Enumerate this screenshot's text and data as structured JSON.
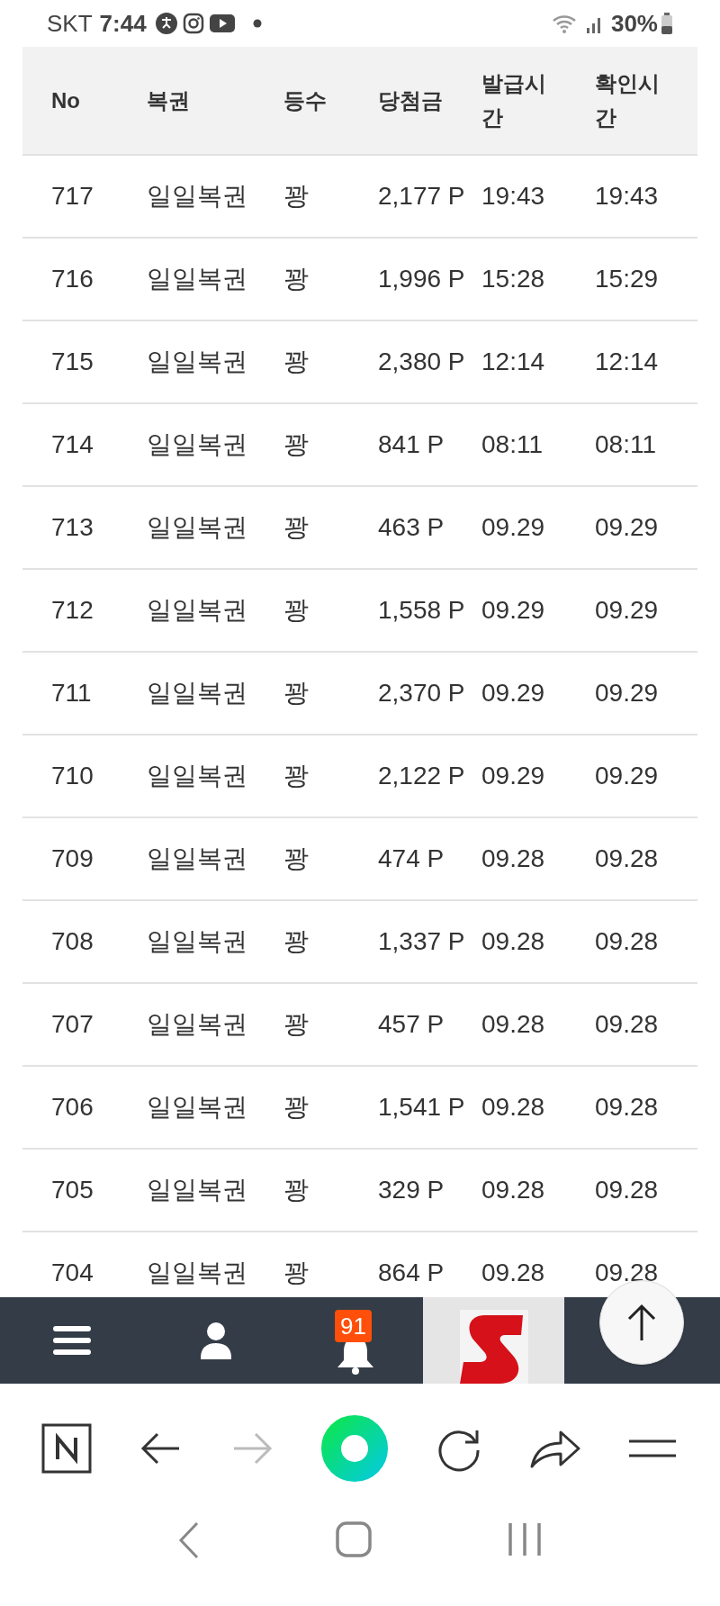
{
  "status_bar": {
    "carrier": "SKT",
    "time": "7:44",
    "battery": "30%"
  },
  "table": {
    "columns": [
      "No",
      "복권",
      "등수",
      "당첨금",
      "발급시간",
      "확인시간"
    ],
    "rows": [
      [
        "717",
        "일일복권",
        "꽝",
        "2,177 P",
        "19:43",
        "19:43"
      ],
      [
        "716",
        "일일복권",
        "꽝",
        "1,996 P",
        "15:28",
        "15:29"
      ],
      [
        "715",
        "일일복권",
        "꽝",
        "2,380 P",
        "12:14",
        "12:14"
      ],
      [
        "714",
        "일일복권",
        "꽝",
        "841 P",
        "08:11",
        "08:11"
      ],
      [
        "713",
        "일일복권",
        "꽝",
        "463 P",
        "09.29",
        "09.29"
      ],
      [
        "712",
        "일일복권",
        "꽝",
        "1,558 P",
        "09.29",
        "09.29"
      ],
      [
        "711",
        "일일복권",
        "꽝",
        "2,370 P",
        "09.29",
        "09.29"
      ],
      [
        "710",
        "일일복권",
        "꽝",
        "2,122 P",
        "09.29",
        "09.29"
      ],
      [
        "709",
        "일일복권",
        "꽝",
        "474 P",
        "09.28",
        "09.28"
      ],
      [
        "708",
        "일일복권",
        "꽝",
        "1,337 P",
        "09.28",
        "09.28"
      ],
      [
        "707",
        "일일복권",
        "꽝",
        "457 P",
        "09.28",
        "09.28"
      ],
      [
        "706",
        "일일복권",
        "꽝",
        "1,541 P",
        "09.28",
        "09.28"
      ],
      [
        "705",
        "일일복권",
        "꽝",
        "329 P",
        "09.28",
        "09.28"
      ],
      [
        "704",
        "일일복권",
        "꽝",
        "864 P",
        "09.28",
        "09.28"
      ]
    ]
  },
  "bottom_bar": {
    "notification_count": "91"
  }
}
